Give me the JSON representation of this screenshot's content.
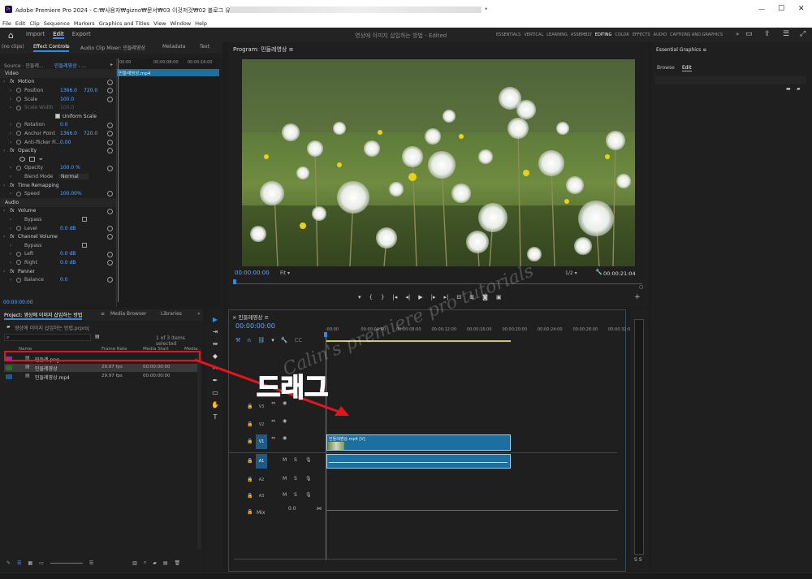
{
  "window": {
    "title": "Adobe Premiere Pro 2024 - C:₩사용자₩gizno₩문서₩03 이것저것₩02 블로그 유튜브₩글감₩티",
    "title_suffix": "*",
    "minimize": "—",
    "maximize": "☐",
    "close": "✕"
  },
  "menu": [
    "File",
    "Edit",
    "Clip",
    "Sequence",
    "Markers",
    "Graphics and Titles",
    "View",
    "Window",
    "Help"
  ],
  "appbar": {
    "nav": [
      "Import",
      "Edit",
      "Export"
    ],
    "active_nav": "Edit",
    "doc_title": "영상에 이미지 삽입하는 방법 - Edited",
    "workspaces": [
      "ESSENTIALS",
      "VERTICAL",
      "LEARNING",
      "ASSEMBLY",
      "EDITING",
      "COLOR",
      "EFFECTS",
      "AUDIO",
      "CAPTIONS AND GRAPHICS"
    ],
    "active_workspace": "EDITING",
    "more": "»"
  },
  "effect_controls": {
    "tabs": [
      "(no clips)",
      "Effect Controls",
      "Audio Clip Mixer: 민들레영상",
      "Metadata",
      "Text"
    ],
    "active_tab": "Effect Controls",
    "menu": "≡",
    "source": "Source · 민들레...",
    "target": "민들레영상 - ...",
    "mini_clip": "민들레영상.mp4",
    "ruler": [
      "00:00",
      "00:00:08:00",
      "00:00:16:00"
    ],
    "rows": [
      {
        "label": "Video",
        "kind": "section"
      },
      {
        "label": "Motion",
        "kind": "fx"
      },
      {
        "label": "Position",
        "v1": "1366.0",
        "v2": "720.0"
      },
      {
        "label": "Scale",
        "v1": "100.0"
      },
      {
        "label": "Scale Width",
        "v1": "100.0",
        "dim": true
      },
      {
        "label": "Uniform Scale",
        "kind": "check",
        "checked": true
      },
      {
        "label": "Rotation",
        "v1": "0.0"
      },
      {
        "label": "Anchor Point",
        "v1": "1366.0",
        "v2": "720.0"
      },
      {
        "label": "Anti-flicker Fi...",
        "v1": "0.00"
      },
      {
        "label": "Opacity",
        "kind": "fx"
      },
      {
        "label": "",
        "kind": "masks"
      },
      {
        "label": "Opacity",
        "v1": "100.0 %"
      },
      {
        "label": "Blend Mode",
        "v1": "Normal",
        "kind": "select"
      },
      {
        "label": "Time Remapping",
        "kind": "fx"
      },
      {
        "label": "Speed",
        "v1": "100.00%"
      },
      {
        "label": "Audio",
        "kind": "section"
      },
      {
        "label": "Volume",
        "kind": "fx"
      },
      {
        "label": "Bypass",
        "kind": "check",
        "checked": false
      },
      {
        "label": "Level",
        "v1": "0.0 dB"
      },
      {
        "label": "Channel Volume",
        "kind": "fx"
      },
      {
        "label": "Bypass",
        "kind": "check",
        "checked": false
      },
      {
        "label": "Left",
        "v1": "0.0 dB"
      },
      {
        "label": "Right",
        "v1": "0.0 dB"
      },
      {
        "label": "Panner",
        "kind": "fx"
      },
      {
        "label": "Balance",
        "v1": "0.0"
      }
    ],
    "timecode": "00:00:00:00"
  },
  "program": {
    "title": "Program: 민들레영상",
    "menu": "≡",
    "timecode": "00:00:00:00",
    "fit": "Fit",
    "quality": "1/2",
    "duration": "00:00:21:04"
  },
  "essential_graphics": {
    "title": "Essential Graphics",
    "menu": "≡",
    "tabs": [
      "Browse",
      "Edit"
    ],
    "active_tab": "Edit"
  },
  "project": {
    "tabs": [
      "Project: 영상에 이미지 삽입하는 방법",
      "Media Browser",
      "Libraries"
    ],
    "menu": "≡",
    "more": "»",
    "file": "영상에 이미지 삽입하는 방법.prproj",
    "count": "1 of 3 items selected",
    "search_placeholder": "",
    "columns": [
      "Name",
      "Frame Rate",
      "Media Start",
      "Media"
    ],
    "items": [
      {
        "name": "민들레.png",
        "fps": "",
        "start": "",
        "color": "#8b2fa4"
      },
      {
        "name": "민들레영상",
        "fps": "29.97 fps",
        "start": "00:00:00:00",
        "color": "#2f6b2f"
      },
      {
        "name": "민들레영상.mp4",
        "fps": "29.97 fps",
        "start": "00:00:00:00",
        "color": "#1b5a8a"
      }
    ]
  },
  "timeline": {
    "title": "민들레영상",
    "menu": "≡",
    "close": "×",
    "timecode": "00:00:00:00",
    "ruler": [
      ":00:00",
      "00:00:04:00",
      "00:00:08:00",
      "00:00:12:00",
      "00:00:16:00",
      "00:00:20:00",
      "00:00:24:00",
      "00:00:28:00",
      "00:00:32:0"
    ],
    "tracks": [
      {
        "name": "V3",
        "kind": "video"
      },
      {
        "name": "V2",
        "kind": "video"
      },
      {
        "name": "V1",
        "kind": "video",
        "target": true
      },
      {
        "name": "A1",
        "kind": "audio",
        "target": true
      },
      {
        "name": "A2",
        "kind": "audio"
      },
      {
        "name": "A3",
        "kind": "audio"
      }
    ],
    "mix_label": "Mix",
    "mix_value": "0.0",
    "clip_label": "민들레영상.mp4 [V]"
  },
  "overlay": {
    "drag_label": "드래그",
    "watermark": "Calin's premiere pro tutorials"
  },
  "colors": {
    "accent": "#2d8ceb",
    "clip": "#1c6f9e",
    "highlight_box": "#e8141b",
    "drag_text": "#e82020"
  }
}
